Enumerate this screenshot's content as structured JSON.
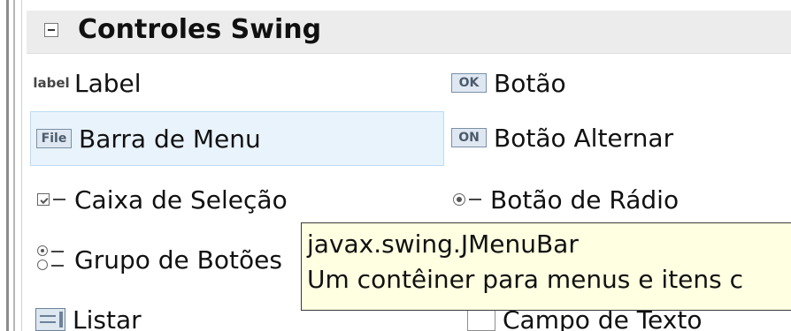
{
  "section": {
    "title": "Controles Swing"
  },
  "items": [
    {
      "label": "Label",
      "icon": "label-icon",
      "icon_text": "label"
    },
    {
      "label": "Botão",
      "icon": "button-icon",
      "icon_text": "OK"
    },
    {
      "label": "Barra de Menu",
      "icon": "menubar-icon",
      "icon_text": "File"
    },
    {
      "label": "Botão Alternar",
      "icon": "toggle-button-icon",
      "icon_text": "ON"
    },
    {
      "label": "Caixa de Seleção",
      "icon": "checkbox-icon"
    },
    {
      "label": "Botão de Rádio",
      "icon": "radio-button-icon"
    },
    {
      "label": "Grupo de Botões",
      "icon": "button-group-icon"
    },
    {
      "label": "Listar",
      "icon": "list-icon"
    },
    {
      "label": "Campo de Texto",
      "icon": "text-field-icon"
    }
  ],
  "tooltip": {
    "line1": "javax.swing.JMenuBar",
    "line2": "Um contêiner para menus e itens c"
  },
  "colors": {
    "header_bg": "#ececec",
    "selected_bg": "#e9f3fb",
    "selected_border": "#bcdcf6",
    "tooltip_bg": "#ffffe1"
  }
}
